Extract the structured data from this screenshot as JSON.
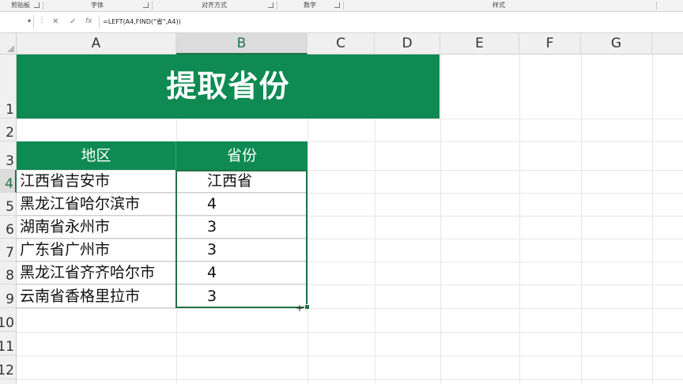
{
  "ribbon": {
    "groups": [
      {
        "label": "剪贴板"
      },
      {
        "label": "字体"
      },
      {
        "label": "对齐方式"
      },
      {
        "label": "数字"
      },
      {
        "label": "样式"
      }
    ]
  },
  "formula_bar": {
    "name_box": "",
    "cancel_icon": "✕",
    "enter_icon": "✓",
    "fx_icon": "fx",
    "formula": "=LEFT(A4,FIND(\"省\",A4))"
  },
  "columns": [
    "A",
    "B",
    "C",
    "D",
    "E",
    "F",
    "G"
  ],
  "rows": [
    "1",
    "2",
    "3",
    "4",
    "5",
    "6",
    "7",
    "8",
    "9",
    "10",
    "11",
    "12"
  ],
  "sheet": {
    "title": "提取省份",
    "header": {
      "col_a": "地区",
      "col_b": "省份"
    },
    "data": [
      {
        "region": "江西省吉安市",
        "province": "江西省"
      },
      {
        "region": "黑龙江省哈尔滨市",
        "province": "4"
      },
      {
        "region": "湖南省永州市",
        "province": "3"
      },
      {
        "region": "广东省广州市",
        "province": "3"
      },
      {
        "region": "黑龙江省齐齐哈尔市",
        "province": "4"
      },
      {
        "region": "云南省香格里拉市",
        "province": "3"
      }
    ]
  },
  "colors": {
    "accent": "#0e8a52",
    "selection": "#217346"
  }
}
